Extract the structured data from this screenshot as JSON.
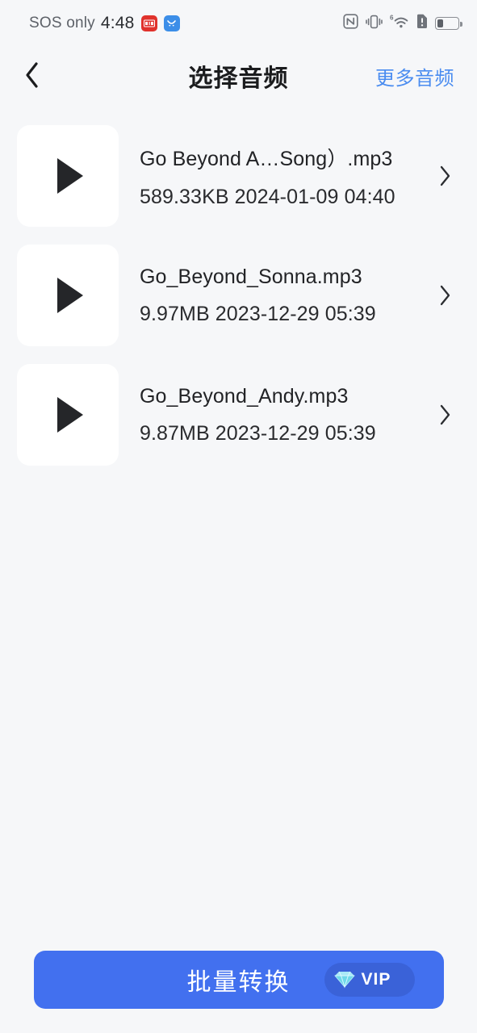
{
  "status_bar": {
    "carrier": "SOS only",
    "time": "4:48",
    "mini_icons": [
      {
        "name": "red-app-icon",
        "color": "#e0322c"
      },
      {
        "name": "blue-app-icon",
        "color": "#3c8ee8"
      }
    ],
    "right_icons": [
      "nfc-icon",
      "vibrate-icon",
      "wifi-6-icon",
      "sim-alert-icon",
      "battery-icon"
    ],
    "wifi_generation": "6",
    "battery_level_percent": 30
  },
  "nav": {
    "back_icon": "chevron-left-icon",
    "title": "选择音频",
    "action_label": "更多音频",
    "action_color": "#4a8cf0"
  },
  "list": {
    "rows": [
      {
        "thumb_icon": "play-icon",
        "title": "Go Beyond A…Song）.mp3",
        "size": "589.33KB",
        "date": "2024-01-09 04:40",
        "meta": "589.33KB 2024-01-09 04:40",
        "chevron_icon": "chevron-right-icon"
      },
      {
        "thumb_icon": "play-icon",
        "title": "Go_Beyond_Sonna.mp3",
        "size": "9.97MB",
        "date": "2023-12-29 05:39",
        "meta": "9.97MB 2023-12-29 05:39",
        "chevron_icon": "chevron-right-icon"
      },
      {
        "thumb_icon": "play-icon",
        "title": "Go_Beyond_Andy.mp3",
        "size": "9.87MB",
        "date": "2023-12-29 05:39",
        "meta": "9.87MB 2023-12-29 05:39",
        "chevron_icon": "chevron-right-icon"
      }
    ]
  },
  "bottom": {
    "cta_label": "批量转换",
    "cta_color": "#4270ef",
    "vip_label": "VIP",
    "vip_badge_color": "#3a62d8",
    "vip_icon": "diamond-gem-icon"
  },
  "theme": {
    "page_background": "#f6f7f9",
    "card_background": "#ffffff",
    "text_primary": "#222326",
    "accent_blue": "#4a8cf0"
  }
}
